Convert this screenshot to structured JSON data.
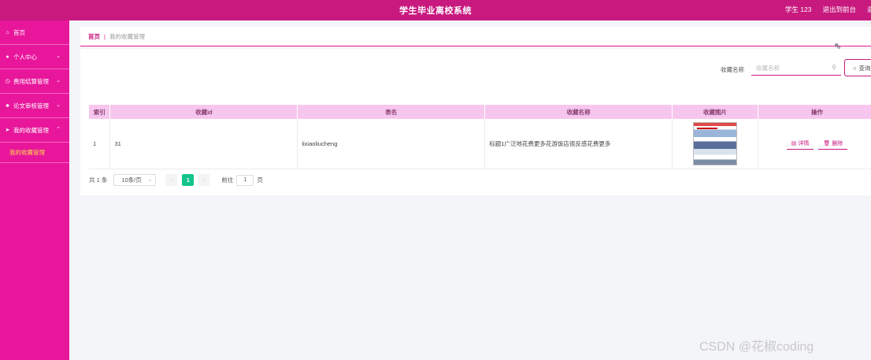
{
  "header": {
    "title": "学生毕业离校系统",
    "user": "学生 123",
    "back_to_front": "退出到前台",
    "logout": "退出"
  },
  "sidebar": {
    "items": [
      {
        "label": "首页",
        "icon": "home-icon"
      },
      {
        "label": "个人中心",
        "icon": "user-icon"
      },
      {
        "label": "费用结算管理",
        "icon": "clock-icon"
      },
      {
        "label": "论文审核管理",
        "icon": "thumbs-up-icon"
      },
      {
        "label": "我的收藏管理",
        "icon": "paper-plane-icon"
      }
    ],
    "sub_item": "我的收藏管理"
  },
  "breadcrumb": {
    "home": "首页",
    "separator": "|",
    "current": "我的收藏管理"
  },
  "search": {
    "label": "收藏名称",
    "placeholder": "收藏名称",
    "button": "查询"
  },
  "table": {
    "headers": [
      "索引",
      "收藏id",
      "表名",
      "收藏名称",
      "收藏图片",
      "操作"
    ],
    "rows": [
      {
        "index": "1",
        "id": "31",
        "table_name": "lixiaoliucheng",
        "name": "标题1广泛地花费更多花游饭店很反感花费更多"
      }
    ],
    "actions": {
      "detail": "详情",
      "delete": "删除"
    }
  },
  "pagination": {
    "total": "共 1 条",
    "page_size": "10条/页",
    "current_page": "1",
    "goto_prefix": "前往",
    "goto_value": "1",
    "goto_suffix": "页"
  },
  "watermark": "CSDN @花椒coding",
  "colors": {
    "primary": "#c8197f",
    "sidebar": "#e8169b",
    "active_sub": "#ffd84a",
    "table_header": "#f6c6ee",
    "page_active": "#13c48b"
  }
}
